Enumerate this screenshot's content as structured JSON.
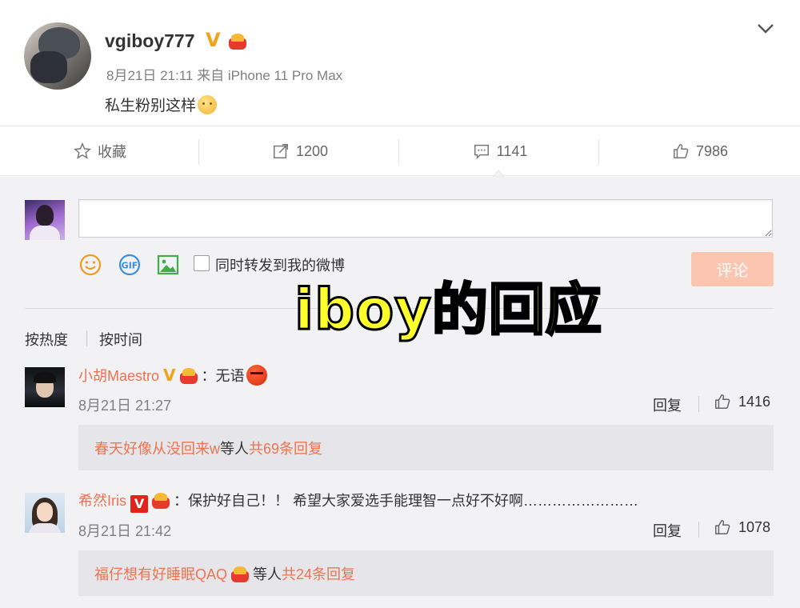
{
  "post": {
    "username": "vgiboy777",
    "verified_mark": "V",
    "time": "8月21日 21:11",
    "source_prefix": "来自",
    "source": "iPhone 11 Pro Max",
    "content": "私生粉别这样"
  },
  "actions": {
    "favorite_label": "收藏",
    "repost_count": "1200",
    "comment_count": "1141",
    "like_count": "7986"
  },
  "composer": {
    "placeholder": "",
    "repost_checkbox_label": "同时转发到我的微博",
    "submit_label": "评论"
  },
  "sort": {
    "by_hot": "按热度",
    "by_time": "按时间"
  },
  "overlay_caption": "iboy的回应",
  "comments": [
    {
      "name": "小胡Maestro",
      "verified_mark": "V",
      "colon": "：",
      "text": "无语",
      "time": "8月21日 21:27",
      "reply_label": "回复",
      "likes": "1416",
      "sub_user": "春天好像从没回来w",
      "sub_mid": " 等人 ",
      "sub_count": "共69条回复"
    },
    {
      "name": "希然Iris",
      "verified_mark": "V",
      "colon": "：",
      "text": "保护好自己！！ 希望大家爱选手能理智一点好不好啊……………………",
      "time": "8月21日 21:42",
      "reply_label": "回复",
      "likes": "1078",
      "sub_user": "福仔想有好睡眠QAQ",
      "sub_mid": " 等人 ",
      "sub_count": "共24条回复"
    }
  ],
  "icons": {
    "star": "star-icon",
    "repost": "repost-icon",
    "comment": "comment-icon",
    "like": "thumbs-up-icon",
    "emoji": "emoji-icon",
    "gif": "gif-icon",
    "image": "image-icon",
    "chevron": "chevron-down-icon"
  },
  "colors": {
    "accent_orange": "#eb7350",
    "submit_disabled": "#fbc5b0",
    "gold_verified": "#f3a21b",
    "red_verified": "#e2231a",
    "overlay_yellow": "#ffff2e"
  }
}
